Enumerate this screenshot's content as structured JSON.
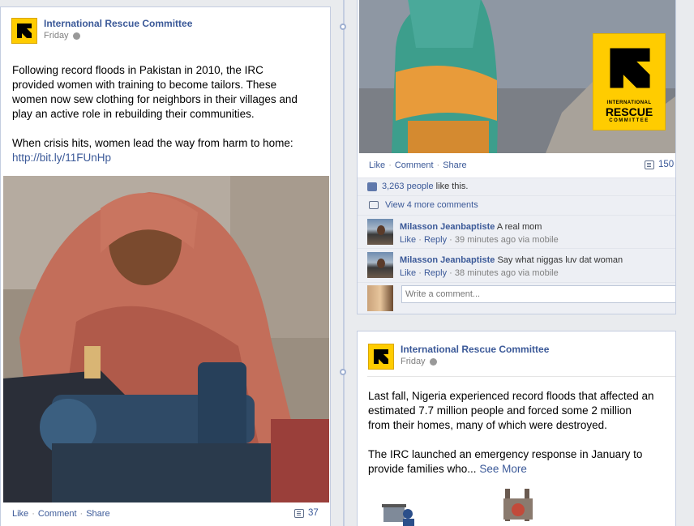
{
  "left_post": {
    "author": "International Rescue Committee",
    "time": "Friday",
    "text_lines": [
      "Following record floods in Pakistan in 2010, the IRC",
      "provided women with training to become tailors. These",
      "women now sew clothing for neighbors in their villages and",
      "play an active role in rebuilding their communities."
    ],
    "text2": "When crisis hits, women lead the way from harm to home:",
    "link": "http://bit.ly/11FUnHp",
    "actions": {
      "like": "Like",
      "comment": "Comment",
      "share": "Share"
    },
    "comment_count": "37"
  },
  "right_top_post": {
    "logo_text": {
      "line1": "INTERNATIONAL",
      "line2": "RESCUE",
      "line3": "COMMITTEE"
    },
    "actions": {
      "like": "Like",
      "comment": "Comment",
      "share": "Share"
    },
    "comment_count": "150",
    "likes_count": "3,263 people",
    "likes_suffix": " like this.",
    "view_more": "View 4 more comments",
    "comments": [
      {
        "author": "Milasson Jeanbaptiste",
        "text": "A real mom",
        "like": "Like",
        "reply": "Reply",
        "meta": "39 minutes ago via mobile"
      },
      {
        "author": "Milasson Jeanbaptiste",
        "text": "Say what niggas luv dat woman",
        "like": "Like",
        "reply": "Reply",
        "meta": "38 minutes ago via mobile"
      }
    ],
    "write_placeholder": "Write a comment..."
  },
  "right_bottom_post": {
    "author": "International Rescue Committee",
    "time": "Friday",
    "text_lines": [
      "Last fall, Nigeria experienced record floods that affected an",
      "estimated 7.7 million people and forced some 2 million",
      "from their homes, many of which were destroyed."
    ],
    "text2_line1": "The IRC launched an emergency response in January to",
    "text2_line2": "provide families who...",
    "see_more": "See More"
  },
  "colors": {
    "link_blue": "#3b5998",
    "irc_yellow": "#ffcc00",
    "ufi_bg": "#edeff4"
  }
}
